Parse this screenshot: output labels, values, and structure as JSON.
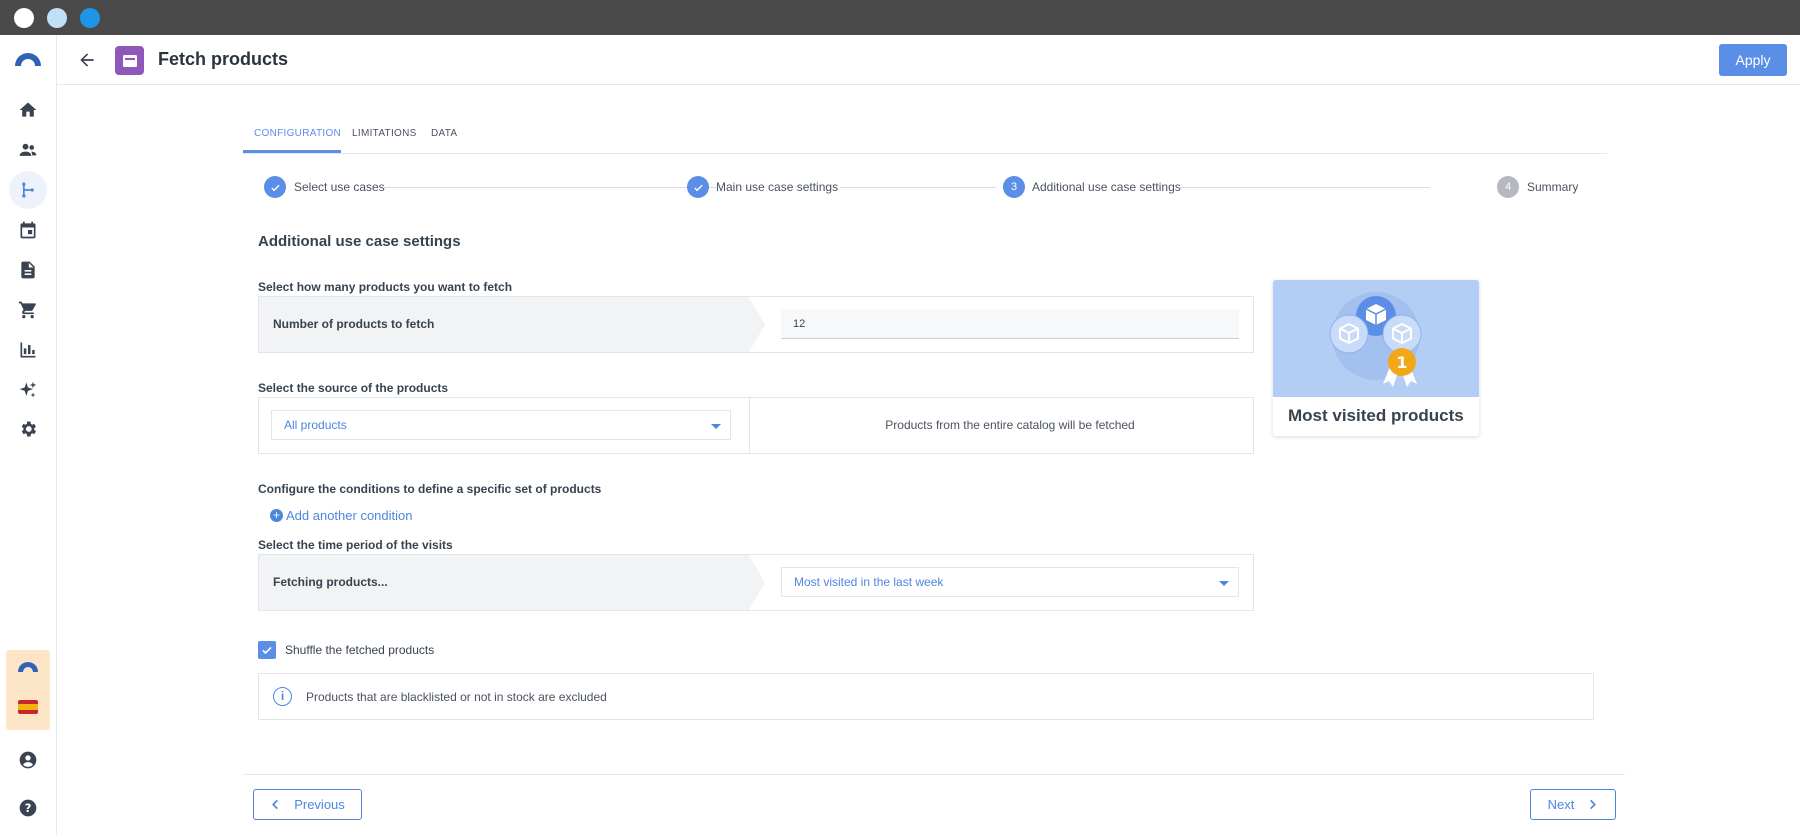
{
  "window": {
    "dots": [
      "#ffffff",
      "#bfe0f7",
      "#1e96e8"
    ]
  },
  "sidebar": {
    "items": [
      {
        "icon": "home-icon"
      },
      {
        "icon": "people-icon"
      },
      {
        "icon": "journey-icon",
        "active": true
      },
      {
        "icon": "calendar-icon"
      },
      {
        "icon": "document-icon"
      },
      {
        "icon": "cart-icon"
      },
      {
        "icon": "chart-icon"
      },
      {
        "icon": "sparkle-icon"
      },
      {
        "icon": "gear-icon"
      }
    ],
    "bottom": [
      "account-icon",
      "help-icon"
    ]
  },
  "header": {
    "title": "Fetch products",
    "apply_label": "Apply"
  },
  "tabs": [
    {
      "label": "CONFIGURATION",
      "active": true
    },
    {
      "label": "LIMITATIONS"
    },
    {
      "label": "DATA"
    }
  ],
  "stepper": [
    {
      "label": "Select use cases",
      "state": "done"
    },
    {
      "label": "Main use case settings",
      "state": "done"
    },
    {
      "label": "Additional use case settings",
      "state": "current",
      "number": "3"
    },
    {
      "label": "Summary",
      "state": "pending",
      "number": "4"
    }
  ],
  "form": {
    "section_title": "Additional use case settings",
    "count_label": "Select how many products you want to fetch",
    "count_row_label": "Number of products to fetch",
    "count_value": "12",
    "source_label": "Select the source of the products",
    "source_value": "All products",
    "source_description": "Products from the entire catalog will be fetched",
    "conditions_label": "Configure the conditions to define a specific set of products",
    "add_condition": "Add another condition",
    "time_label": "Select the time period of the visits",
    "time_row_label": "Fetching products...",
    "time_value": "Most visited in the last week",
    "shuffle_label": "Shuffle the fetched products",
    "shuffle_checked": true,
    "info_text": "Products that are blacklisted or not in stock are excluded"
  },
  "preview": {
    "title": "Most visited products",
    "badge": "1"
  },
  "footer": {
    "previous_label": "Previous",
    "next_label": "Next"
  },
  "colors": {
    "accent": "#5b8ee6",
    "title_icon": "#8f57b9",
    "badge": "#f0a818"
  }
}
